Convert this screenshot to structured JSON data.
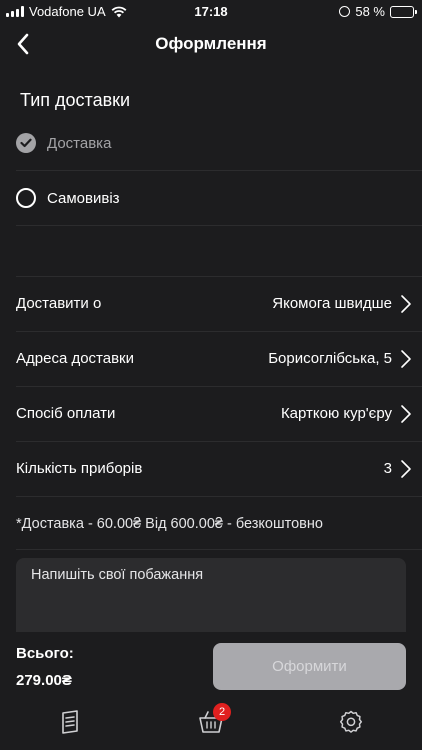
{
  "status_bar": {
    "carrier": "Vodafone UA",
    "time": "17:18",
    "battery": "58 %",
    "battery_level": 0.58
  },
  "header": {
    "title": "Оформлення"
  },
  "delivery_type": {
    "title": "Тип доставки",
    "options": [
      {
        "label": "Доставка",
        "selected": true
      },
      {
        "label": "Самовивіз",
        "selected": false
      }
    ]
  },
  "settings": [
    {
      "label": "Доставити о",
      "value": "Якомога швидше"
    },
    {
      "label": "Адреса доставки",
      "value": "Борисоглібська, 5"
    },
    {
      "label": "Спосіб оплати",
      "value": "Карткою кур'єру"
    },
    {
      "label": "Кількість приборів",
      "value": "3"
    }
  ],
  "note": "*Доставка - 60.00₴ Від 600.00₴ - безкоштовно",
  "wishes": {
    "placeholder": "Напишіть свої побажання",
    "value": ""
  },
  "footer": {
    "total_label": "Всього:",
    "total_value": "279.00₴",
    "checkout_label": "Оформити"
  },
  "tab_bar": {
    "cart_badge": "2",
    "icons": [
      "menu-icon",
      "cart-icon",
      "gear-icon"
    ]
  },
  "colors": {
    "background": "#1c1c1e",
    "field": "#2c2c2e",
    "button_disabled": "#a9a9ad",
    "badge": "#e0201f"
  }
}
